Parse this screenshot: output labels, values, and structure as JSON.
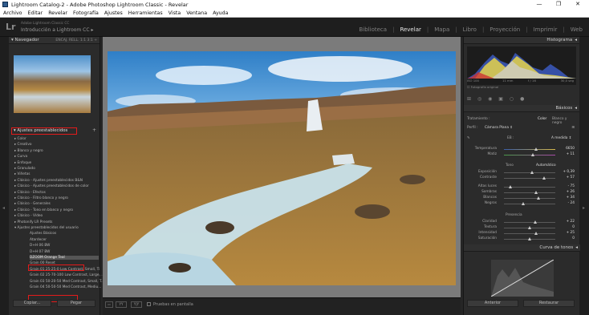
{
  "window": {
    "title": "Lightroom Catalog-2 - Adobe Photoshop Lightroom Classic - Revelar",
    "controls": [
      "—",
      "❐",
      "✕"
    ]
  },
  "menu": [
    "Archivo",
    "Editar",
    "Revelar",
    "Fotografía",
    "Ajustes",
    "Herramientas",
    "Vista",
    "Ventana",
    "Ayuda"
  ],
  "identity": {
    "logo": "Lr",
    "catalog": "Adobe Lightroom Classic CC",
    "user": "Introducción a Lightroom CC",
    "arrow": "▸"
  },
  "modules": [
    "Biblioteca",
    "Revelar",
    "Mapa",
    "Libro",
    "Proyección",
    "Imprimir",
    "Web"
  ],
  "active_module": "Revelar",
  "navigator": {
    "title": "Navegador",
    "zoom": "ENCAJ.   RELL.   1:1   3:1 ÷"
  },
  "presets": {
    "header": "Ajustes preestablecidos",
    "plus": "+",
    "items": [
      "▸ Color",
      "▸ Creativo",
      "▸ Blanco y negro",
      "▸ Curva",
      "▸ Enfoque",
      "▸ Granulado",
      "▸ Viñetas",
      "▸ Clásico - Ajustes preestablecidos B&N",
      "▸ Clásico - Ajustes preestablecidos de color",
      "▸ Clásico - Efectos",
      "▸ Clásico - Filtro blanco y negro",
      "▸ Clásico - Generales",
      "▸ Clásico - Tono en blanco y negro",
      "▸ Clásico - Vídeo",
      "▸ Photonify LR Presets",
      "▾ Ajustes preestablecidos del usuario",
      "Ajustes Básicos",
      "Atardecer",
      "D+H 06 BW",
      "D+H 07 BW",
      "DZOOM Orange Teal",
      "Grain 00 Reset",
      "Grain 01 25-25-0 Low Contrast, Small, Ti",
      "Grain 02 25-70-100 Low Contrast, Large, ...",
      "Grain 03 50-20-50 Med Contrast, Small, T...",
      "Grain 04 50-50-50 Med Contrast, Mediu..."
    ]
  },
  "left_buttons": {
    "copy": "Copiar...",
    "paste": "Pegar"
  },
  "toolbar": {
    "proof": "Pruebas en pantalla",
    "view_icons": [
      "▭",
      "YY",
      "Y|Y"
    ]
  },
  "histogram": {
    "title": "Histograma",
    "iso": "ISO 100",
    "focal": "11 mm",
    "aperture": "f / 16",
    "shutter": "30,0 seg",
    "original": "Fotografía original"
  },
  "basic": {
    "title": "Básicos",
    "treatment_label": "Tratamiento :",
    "color": "Color",
    "bw": "Blanco y negro",
    "profile_label": "Perfil :",
    "profile": "Cámara Plana ⇕",
    "wb_label": "EB :",
    "wb_value": "A medida ⇕",
    "tone_label": "Tono",
    "auto": "Automático",
    "presence_label": "Presencia",
    "sliders": [
      {
        "label": "Temperatura",
        "value": "6650",
        "pos": 0.62
      },
      {
        "label": "Matiz",
        "value": "+ 11",
        "pos": 0.56
      },
      {
        "label": "Exposición",
        "value": "+ 0,39",
        "pos": 0.54
      },
      {
        "label": "Contraste",
        "value": "+ 57",
        "pos": 0.78
      },
      {
        "label": "Altas luces",
        "value": "- 75",
        "pos": 0.12
      },
      {
        "label": "Sombras",
        "value": "+ 26",
        "pos": 0.63
      },
      {
        "label": "Blancos",
        "value": "+ 34",
        "pos": 0.67
      },
      {
        "label": "Negros",
        "value": "- 24",
        "pos": 0.38
      },
      {
        "label": "Claridad",
        "value": "+ 22",
        "pos": 0.61
      },
      {
        "label": "Textura",
        "value": "0",
        "pos": 0.5
      },
      {
        "label": "Intensidad",
        "value": "+ 25",
        "pos": 0.62
      },
      {
        "label": "Saturación",
        "value": "0",
        "pos": 0.5
      }
    ]
  },
  "curve": {
    "title": "Curva de tonos"
  },
  "right_buttons": {
    "previous": "Anterior",
    "reset": "Restaurar"
  },
  "colors": {
    "highlight": "#e31b1b",
    "active_module": "#e6e6e6"
  }
}
